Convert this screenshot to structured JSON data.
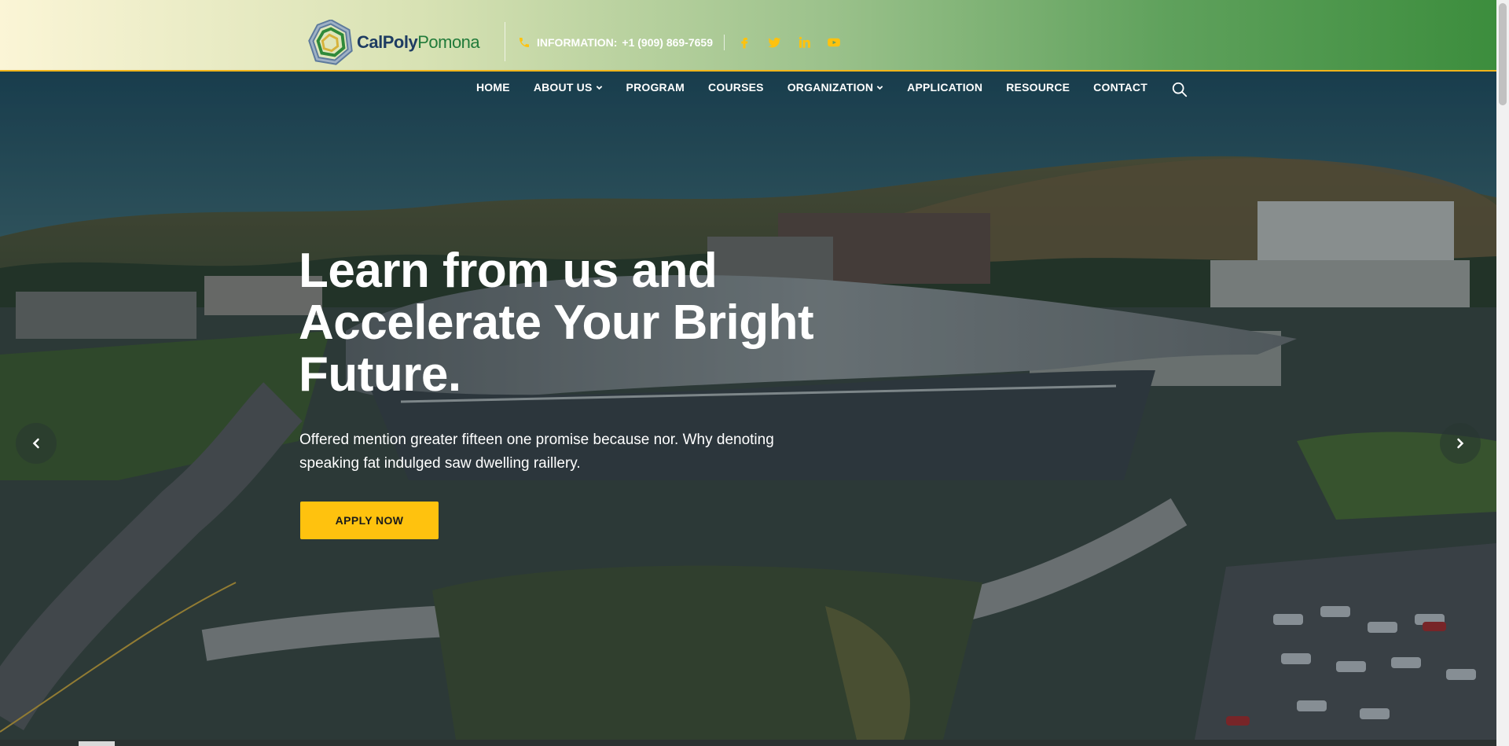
{
  "brand": {
    "name_part1": "CalPoly",
    "name_part2": "Pomona"
  },
  "contact": {
    "label": "Information:",
    "phone": "+1 (909) 869-7659"
  },
  "socials": [
    "facebook-icon",
    "twitter-icon",
    "linkedin-icon",
    "youtube-icon"
  ],
  "nav": {
    "items": [
      {
        "label": "HOME",
        "has_dropdown": false
      },
      {
        "label": "ABOUT US",
        "has_dropdown": true
      },
      {
        "label": "PROGRAM",
        "has_dropdown": false
      },
      {
        "label": "COURSES",
        "has_dropdown": false
      },
      {
        "label": "ORGANIZATION",
        "has_dropdown": true
      },
      {
        "label": "APPLICATION",
        "has_dropdown": false
      },
      {
        "label": "RESOURCE",
        "has_dropdown": false
      },
      {
        "label": "CONTACT",
        "has_dropdown": false
      }
    ]
  },
  "hero": {
    "headline_line1": "Learn from us and",
    "headline_line2": "Accelerate Your Bright",
    "headline_line3": "Future.",
    "subtext": "Offered mention greater fifteen one promise because nor. Why denoting speaking fat indulged saw dwelling raillery.",
    "cta_label": "APPLY NOW"
  },
  "colors": {
    "accent": "#ffc20e",
    "topbar_start": "#fbf5d6",
    "topbar_end": "#3c8d3d",
    "rule": "#f0b41a"
  }
}
